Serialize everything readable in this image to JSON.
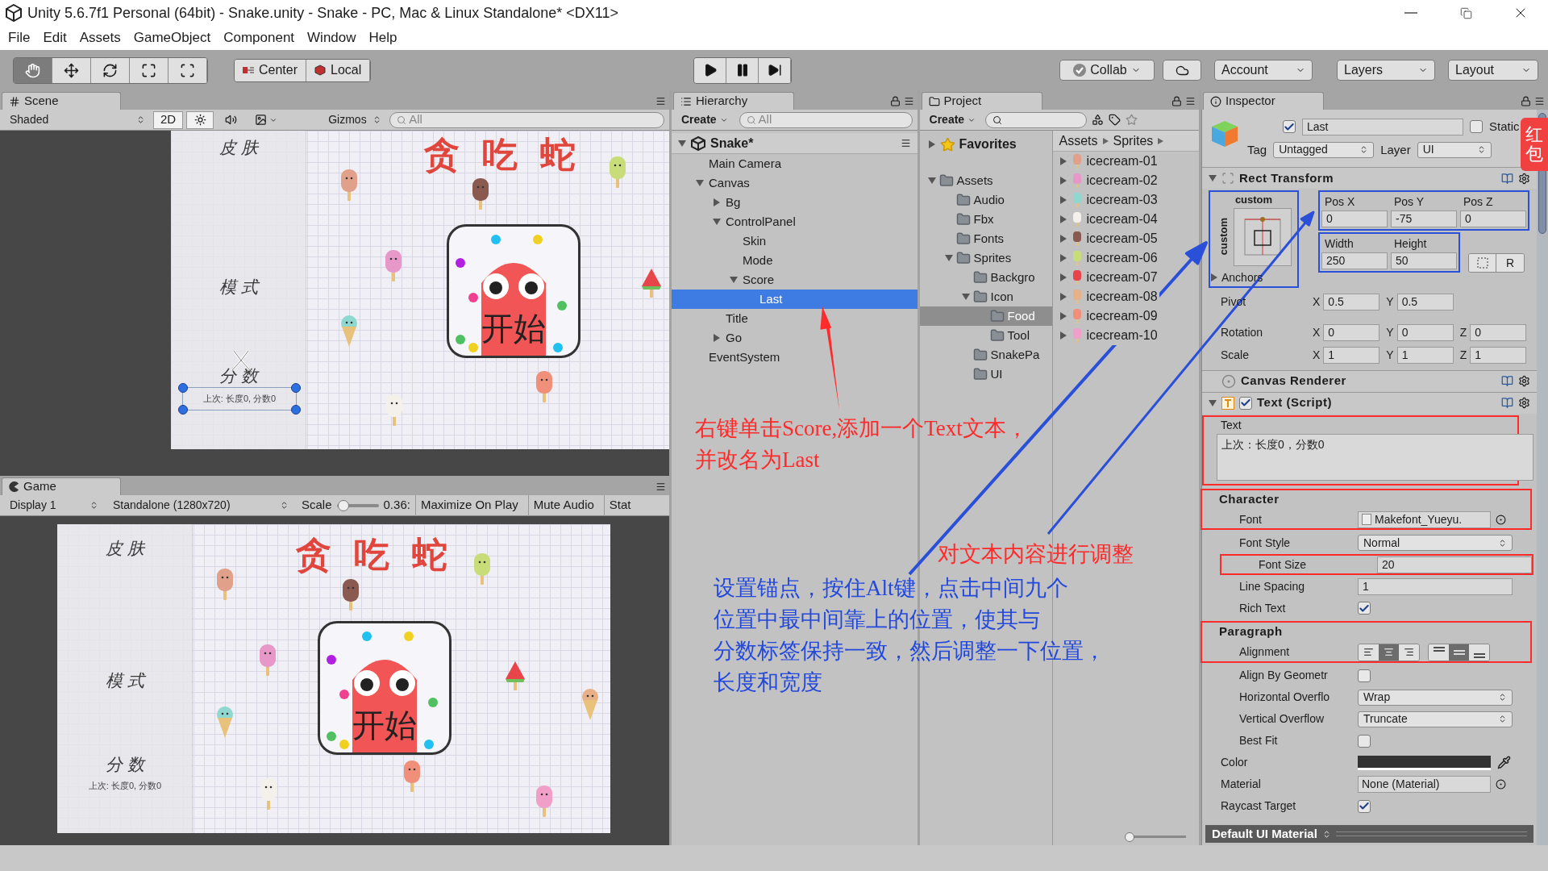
{
  "window": {
    "title": "Unity 5.6.7f1 Personal (64bit) - Snake.unity - Snake - PC, Mac & Linux Standalone* <DX11>"
  },
  "menu": [
    "File",
    "Edit",
    "Assets",
    "GameObject",
    "Component",
    "Window",
    "Help"
  ],
  "toolbar": {
    "tools": [
      {
        "kind": "hand",
        "selected": true
      },
      {
        "kind": "move",
        "selected": false
      },
      {
        "kind": "rotate",
        "selected": false
      },
      {
        "kind": "scale",
        "selected": false
      },
      {
        "kind": "rect",
        "selected": false
      }
    ],
    "pivot_buttons": [
      {
        "kind": "center",
        "label": "Center"
      },
      {
        "kind": "local",
        "label": "Local"
      }
    ],
    "play_controls": [
      {
        "kind": "play"
      },
      {
        "kind": "pause"
      },
      {
        "kind": "step"
      }
    ],
    "collab": "Collab",
    "account": "Account",
    "layers": "Layers",
    "layout": "Layout"
  },
  "scene": {
    "tab": "Scene",
    "shading": "Shaded",
    "mode_2d": {
      "label": "2D",
      "on": true
    },
    "lighting": {
      "on": true
    },
    "gizmos": "Gizmos",
    "search": {
      "placeholder": "All"
    },
    "canvas": {
      "labels": [
        "皮 肤",
        "模 式",
        "分 数"
      ],
      "last_score": "上次:  长度0,  分数0",
      "title": "贪 吃 蛇",
      "start_button": "开始",
      "selected": true
    }
  },
  "game": {
    "tab": "Game",
    "display": "Display 1",
    "resolution": "Standalone (1280x720)",
    "scale": {
      "label": "Scale",
      "level": 0.05,
      "reading": "0.36:"
    },
    "buttons": [
      "Maximize On Play",
      "Mute Audio",
      "Stat"
    ],
    "canvas": {
      "labels": [
        "皮 肤",
        "模 式",
        "分 数"
      ],
      "last_score": "上次:  长度0,  分数0",
      "title": "贪 吃 蛇",
      "start_button": "开始",
      "selected": false
    }
  },
  "hierarchy": {
    "tab": "Hierarchy",
    "create": "Create",
    "search": {
      "placeholder": "All"
    },
    "scene": {
      "label": "Snake*",
      "expanded": true
    },
    "items": [
      {
        "label": "Main Camera",
        "selected": false
      },
      {
        "label": "Canvas",
        "selected": false,
        "expanded": true,
        "children": [
          {
            "label": "Bg",
            "selected": false,
            "expanded": false
          },
          {
            "label": "ControlPanel",
            "selected": false,
            "expanded": true,
            "children": [
              {
                "label": "Skin",
                "selected": false
              },
              {
                "label": "Mode",
                "selected": false
              },
              {
                "label": "Score",
                "selected": false,
                "expanded": true,
                "children": [
                  {
                    "label": "Last",
                    "selected": true
                  }
                ]
              }
            ]
          },
          {
            "label": "Title",
            "selected": false
          },
          {
            "label": "Go",
            "selected": false,
            "expanded": false
          }
        ]
      },
      {
        "label": "EventSystem",
        "selected": false
      }
    ]
  },
  "project": {
    "tab": "Project",
    "create": "Create",
    "favorites": {
      "label": "Favorites",
      "expanded": false
    },
    "folders": [
      {
        "label": "Assets",
        "selected": false,
        "expanded": true,
        "children": [
          {
            "label": "Audio",
            "selected": false
          },
          {
            "label": "Fbx",
            "selected": false
          },
          {
            "label": "Fonts",
            "selected": false
          },
          {
            "label": "Sprites",
            "selected": false,
            "expanded": true,
            "children": [
              {
                "label": "Backgro",
                "selected": false
              },
              {
                "label": "Icon",
                "selected": false,
                "expanded": true,
                "children": [
                  {
                    "label": "Food",
                    "selected": true
                  },
                  {
                    "label": "Tool",
                    "selected": false
                  }
                ]
              },
              {
                "label": "SnakePa",
                "selected": false
              },
              {
                "label": "UI",
                "selected": false
              }
            ]
          }
        ]
      }
    ],
    "breadcrumb": [
      "Assets",
      "Sprites"
    ],
    "files": [
      {
        "name": "icecream-01",
        "expanded": false
      },
      {
        "name": "icecream-02",
        "expanded": false
      },
      {
        "name": "icecream-03",
        "expanded": false
      },
      {
        "name": "icecream-04",
        "expanded": false
      },
      {
        "name": "icecream-05",
        "expanded": false
      },
      {
        "name": "icecream-06",
        "expanded": false
      },
      {
        "name": "icecream-07",
        "expanded": false
      },
      {
        "name": "icecream-08",
        "expanded": false
      },
      {
        "name": "icecream-09",
        "expanded": false
      },
      {
        "name": "icecream-10",
        "expanded": false
      }
    ],
    "icon_size": {
      "level": 0
    }
  },
  "inspector": {
    "tab": "Inspector",
    "object": {
      "active": true,
      "name": "Last",
      "static": {
        "label": "Static",
        "checked": false
      },
      "tag": {
        "label": "Tag",
        "value": "Untagged"
      },
      "layer": {
        "label": "Layer",
        "value": "UI"
      }
    },
    "badge": "红包",
    "rect_transform": {
      "title": "Rect Transform",
      "anchor_h": "custom",
      "anchor_v": "custom",
      "anchors": {
        "label": "Anchors",
        "expanded": false
      },
      "fields": [
        {
          "label": "Pos X",
          "value": "0"
        },
        {
          "label": "Pos Y",
          "value": "-75"
        },
        {
          "label": "Pos Z",
          "value": "0"
        },
        {
          "label": "Width",
          "value": "250"
        },
        {
          "label": "Height",
          "value": "50"
        }
      ],
      "raw_button": "R",
      "vectors": [
        {
          "label": "Pivot",
          "axes": [
            {
              "axis": "X",
              "value": "0.5"
            },
            {
              "axis": "Y",
              "value": "0.5"
            }
          ]
        },
        {
          "label": "Rotation",
          "axes": [
            {
              "axis": "X",
              "value": "0"
            },
            {
              "axis": "Y",
              "value": "0"
            },
            {
              "axis": "Z",
              "value": "0"
            }
          ]
        },
        {
          "label": "Scale",
          "axes": [
            {
              "axis": "X",
              "value": "1"
            },
            {
              "axis": "Y",
              "value": "1"
            },
            {
              "axis": "Z",
              "value": "1"
            }
          ]
        }
      ]
    },
    "canvas_renderer": {
      "title": "Canvas Renderer"
    },
    "text_script": {
      "title": "Text (Script)",
      "enabled": true,
      "expanded": true,
      "text_label": "Text",
      "text_value": "上次：长度0，分数0",
      "sections": [
        {
          "title": "Character",
          "rows": [
            {
              "kind": "object",
              "label": "Font",
              "value": "Makefont_Yueyu."
            },
            {
              "kind": "dropdown",
              "label": "Font Style",
              "value": "Normal"
            },
            {
              "kind": "field",
              "label": "Font Size",
              "value": "20"
            },
            {
              "kind": "field",
              "label": "Line Spacing",
              "value": "1"
            },
            {
              "kind": "checkbox",
              "label": "Rich Text",
              "checked": true
            }
          ]
        },
        {
          "title": "Paragraph",
          "rows": [
            {
              "kind": "alignment",
              "label": "Alignment",
              "horizontal": [
                {
                  "selected": false
                },
                {
                  "selected": true
                },
                {
                  "selected": false
                }
              ],
              "vertical": [
                {
                  "selected": false
                },
                {
                  "selected": true
                },
                {
                  "selected": false
                }
              ]
            },
            {
              "kind": "checkbox",
              "label": "Align By Geometr",
              "checked": false
            },
            {
              "kind": "dropdown",
              "label": "Horizontal Overflo",
              "value": "Wrap"
            },
            {
              "kind": "dropdown",
              "label": "Vertical Overflow",
              "value": "Truncate"
            },
            {
              "kind": "checkbox",
              "label": "Best Fit",
              "checked": false
            }
          ]
        }
      ],
      "rows": [
        {
          "kind": "color",
          "label": "Color",
          "color": "#323232"
        },
        {
          "kind": "object",
          "label": "Material",
          "value": "None (Material)"
        },
        {
          "kind": "checkbox",
          "label": "Raycast Target",
          "checked": true
        }
      ]
    },
    "footer": "Default UI Material"
  },
  "annotations": [
    {
      "lines": [
        "右键单击Score,添加一个Text文本，",
        "并改名为Last"
      ],
      "color": "#ff2a2a"
    },
    {
      "lines": [
        "对文本内容进行调整"
      ],
      "color": "#ff2a2a"
    },
    {
      "lines": [
        "设置锚点，按住Alt键，点击中间九个",
        "位置中最中间靠上的位置，使其与",
        "分数标签保持一致，然后调整一下位置，",
        "长度和宽度"
      ],
      "color": "#2248dd"
    }
  ]
}
